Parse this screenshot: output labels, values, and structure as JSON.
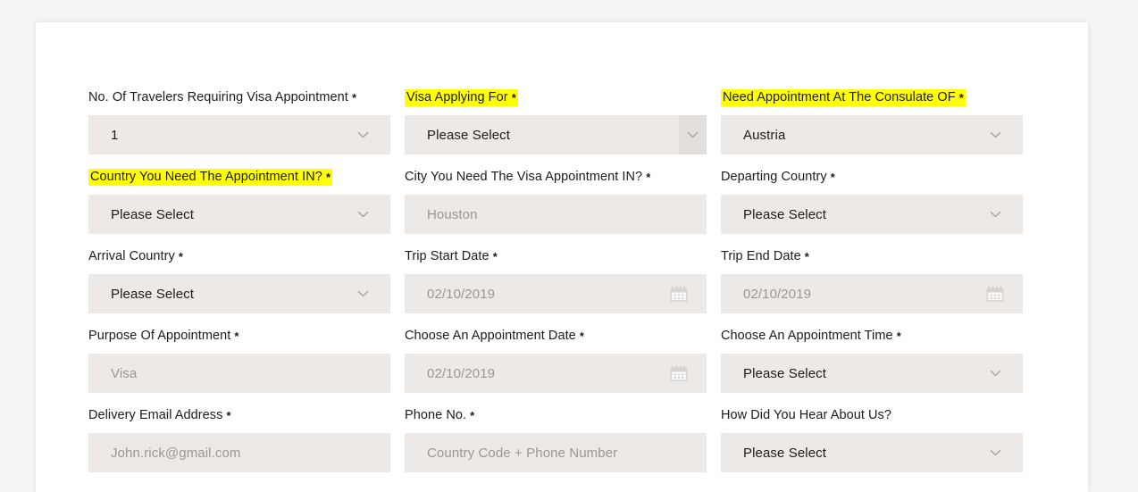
{
  "form": {
    "fields": [
      {
        "label": "No. Of Travelers Requiring Visa Appointment",
        "required": "*",
        "highlighted": false,
        "type": "select",
        "value": "1",
        "is_placeholder": false,
        "icon": "chevron-down-icon",
        "name": "travelers-count"
      },
      {
        "label": "Visa Applying For",
        "required": "*",
        "highlighted": true,
        "type": "select-open",
        "value": "Please Select",
        "is_placeholder": false,
        "icon": "chevron-down-icon",
        "name": "visa-applying-for"
      },
      {
        "label": "Need Appointment At The Consulate OF",
        "required": "*",
        "highlighted": true,
        "type": "select",
        "value": "Austria",
        "is_placeholder": false,
        "icon": "chevron-down-icon",
        "name": "consulate-country"
      },
      {
        "label": "Country You Need The Appointment IN?",
        "required": "*",
        "highlighted": true,
        "type": "select",
        "value": "Please Select",
        "is_placeholder": false,
        "icon": "chevron-down-icon",
        "name": "appointment-country"
      },
      {
        "label": "City You Need The Visa Appointment IN?",
        "required": "*",
        "highlighted": false,
        "type": "text",
        "value": "Houston",
        "is_placeholder": true,
        "icon": "",
        "name": "appointment-city"
      },
      {
        "label": "Departing Country",
        "required": "*",
        "highlighted": false,
        "type": "select",
        "value": "Please Select",
        "is_placeholder": false,
        "icon": "chevron-down-icon",
        "name": "departing-country"
      },
      {
        "label": "Arrival Country",
        "required": "*",
        "highlighted": false,
        "type": "select",
        "value": "Please Select",
        "is_placeholder": false,
        "icon": "chevron-down-icon",
        "name": "arrival-country"
      },
      {
        "label": "Trip Start Date",
        "required": "*",
        "highlighted": false,
        "type": "date",
        "value": "02/10/2019",
        "is_placeholder": true,
        "icon": "calendar-icon",
        "name": "trip-start-date"
      },
      {
        "label": "Trip End Date",
        "required": "*",
        "highlighted": false,
        "type": "date",
        "value": "02/10/2019",
        "is_placeholder": true,
        "icon": "calendar-icon",
        "name": "trip-end-date"
      },
      {
        "label": "Purpose Of Appointment",
        "required": "*",
        "highlighted": false,
        "type": "text",
        "value": "Visa",
        "is_placeholder": true,
        "icon": "",
        "name": "purpose-of-appointment"
      },
      {
        "label": "Choose An Appointment Date",
        "required": "*",
        "highlighted": false,
        "type": "date",
        "value": "02/10/2019",
        "is_placeholder": true,
        "icon": "calendar-icon",
        "name": "appointment-date"
      },
      {
        "label": "Choose An Appointment Time",
        "required": "*",
        "highlighted": false,
        "type": "select",
        "value": "Please Select",
        "is_placeholder": false,
        "icon": "chevron-down-icon",
        "name": "appointment-time"
      },
      {
        "label": "Delivery Email Address",
        "required": "*",
        "highlighted": false,
        "type": "text",
        "value": "John.rick@gmail.com",
        "is_placeholder": true,
        "icon": "",
        "name": "delivery-email-address"
      },
      {
        "label": "Phone No.",
        "required": "*",
        "highlighted": false,
        "type": "text",
        "value": "Country Code + Phone Number",
        "is_placeholder": true,
        "icon": "",
        "name": "phone-number"
      },
      {
        "label": "How Did You Hear About Us?",
        "required": "",
        "highlighted": false,
        "type": "select",
        "value": "Please Select",
        "is_placeholder": false,
        "icon": "chevron-down-icon",
        "name": "referral-source"
      }
    ]
  },
  "colors": {
    "page_background": "#f5f5f5",
    "card_background": "#ffffff",
    "field_background": "#ece9e7",
    "highlight": "#ffff00",
    "label_text": "#1c1c1c",
    "placeholder_text": "#9b9793"
  }
}
